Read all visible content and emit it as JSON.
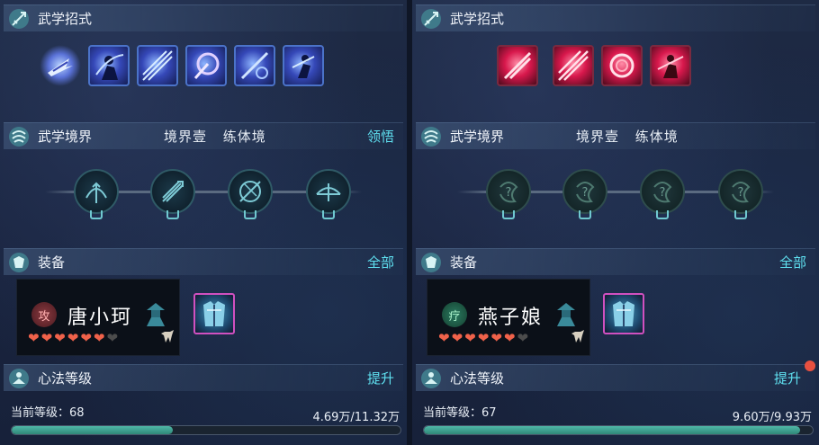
{
  "left": {
    "skills_section": {
      "title": "武学招式",
      "skills": [
        "skill-1",
        "skill-2",
        "skill-3",
        "skill-4",
        "skill-5",
        "skill-6"
      ]
    },
    "realm_section": {
      "title": "武学境界",
      "realm_name": "境界壹",
      "realm_stage": "练体境",
      "action_label": "领悟",
      "nodes": [
        "bow-arrow-icon",
        "arrow-volley-icon",
        "arrow-target-icon",
        "bow-aim-icon"
      ]
    },
    "equip_section": {
      "title": "装备",
      "action_label": "全部",
      "character": {
        "role_glyph": "攻",
        "name": "唐小珂",
        "hearts_filled": 6,
        "hearts_total": 7
      }
    },
    "level_section": {
      "title": "心法等级",
      "action_label": "提升",
      "current_level_text": "当前等级：68",
      "exp_text": "4.69万/11.32万",
      "progress": 0.414
    }
  },
  "right": {
    "skills_section": {
      "title": "武学招式",
      "skills": [
        "skill-1",
        "skill-2",
        "skill-3",
        "skill-4"
      ]
    },
    "realm_section": {
      "title": "武学境界",
      "realm_name": "境界壹",
      "realm_stage": "练体境",
      "nodes": [
        "unknown-icon",
        "unknown-icon",
        "unknown-icon",
        "unknown-icon"
      ]
    },
    "equip_section": {
      "title": "装备",
      "action_label": "全部",
      "character": {
        "role_glyph": "疗",
        "name": "燕子娘",
        "hearts_filled": 6,
        "hearts_total": 7
      }
    },
    "level_section": {
      "title": "心法等级",
      "action_label": "提升",
      "current_level_text": "当前等级：67",
      "exp_text": "9.60万/9.93万",
      "progress": 0.967,
      "has_notice": true
    }
  },
  "colors": {
    "accent_link": "#5fe0f0",
    "heart": "#f0624a",
    "progress_fill": "#4fb8a8",
    "notice": "#e85040"
  }
}
